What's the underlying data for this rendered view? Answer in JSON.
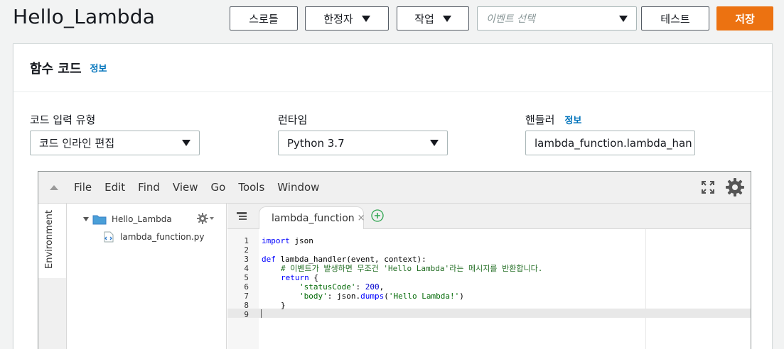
{
  "header": {
    "title": "Hello_Lambda",
    "buttons": {
      "throttle": "스로틀",
      "qualifier": "한정자",
      "actions": "작업",
      "test": "테스트",
      "save": "저장"
    },
    "event_select_placeholder": "이벤트 선택"
  },
  "function_code": {
    "title": "함수 코드",
    "info_link": "정보",
    "code_entry_type": {
      "label": "코드 입력 유형",
      "value": "코드 인라인 편집"
    },
    "runtime": {
      "label": "런타임",
      "value": "Python 3.7"
    },
    "handler": {
      "label": "핸들러",
      "info_link": "정보",
      "value": "lambda_function.lambda_han"
    }
  },
  "ide": {
    "menu": [
      "File",
      "Edit",
      "Find",
      "View",
      "Go",
      "Tools",
      "Window"
    ],
    "side_tab_label": "Environment",
    "tree": {
      "folder": "Hello_Lambda",
      "file": "lambda_function.py"
    },
    "active_tab": "lambda_function",
    "tab_close": "×",
    "line_numbers": [
      "1",
      "2",
      "3",
      "4",
      "5",
      "6",
      "7",
      "8",
      "9"
    ],
    "code": {
      "l1_kw": "import",
      "l1_rest": " json",
      "l3_kw": "def",
      "l3_rest": " lambda_handler(event, context):",
      "l4_comment": "# 이벤트가 발생하면 무조건 'Hello Lambda'라는 메시지를 반환합니다.",
      "l5_kw": "return",
      "l5_rest": " {",
      "l6_str": "'statusCode'",
      "l6_mid": ": ",
      "l6_num": "200",
      "l6_end": ",",
      "l7_str": "'body'",
      "l7_mid": ": json.",
      "l7_fn": "dumps",
      "l7_open": "(",
      "l7_arg": "'Hello Lambda!'",
      "l7_close": ")",
      "l8": "}"
    }
  },
  "colors": {
    "primary": "#ec7211",
    "link": "#0073bb",
    "folder_icon": "#4a9fd8",
    "add_tab_icon": "#2ea44f"
  }
}
